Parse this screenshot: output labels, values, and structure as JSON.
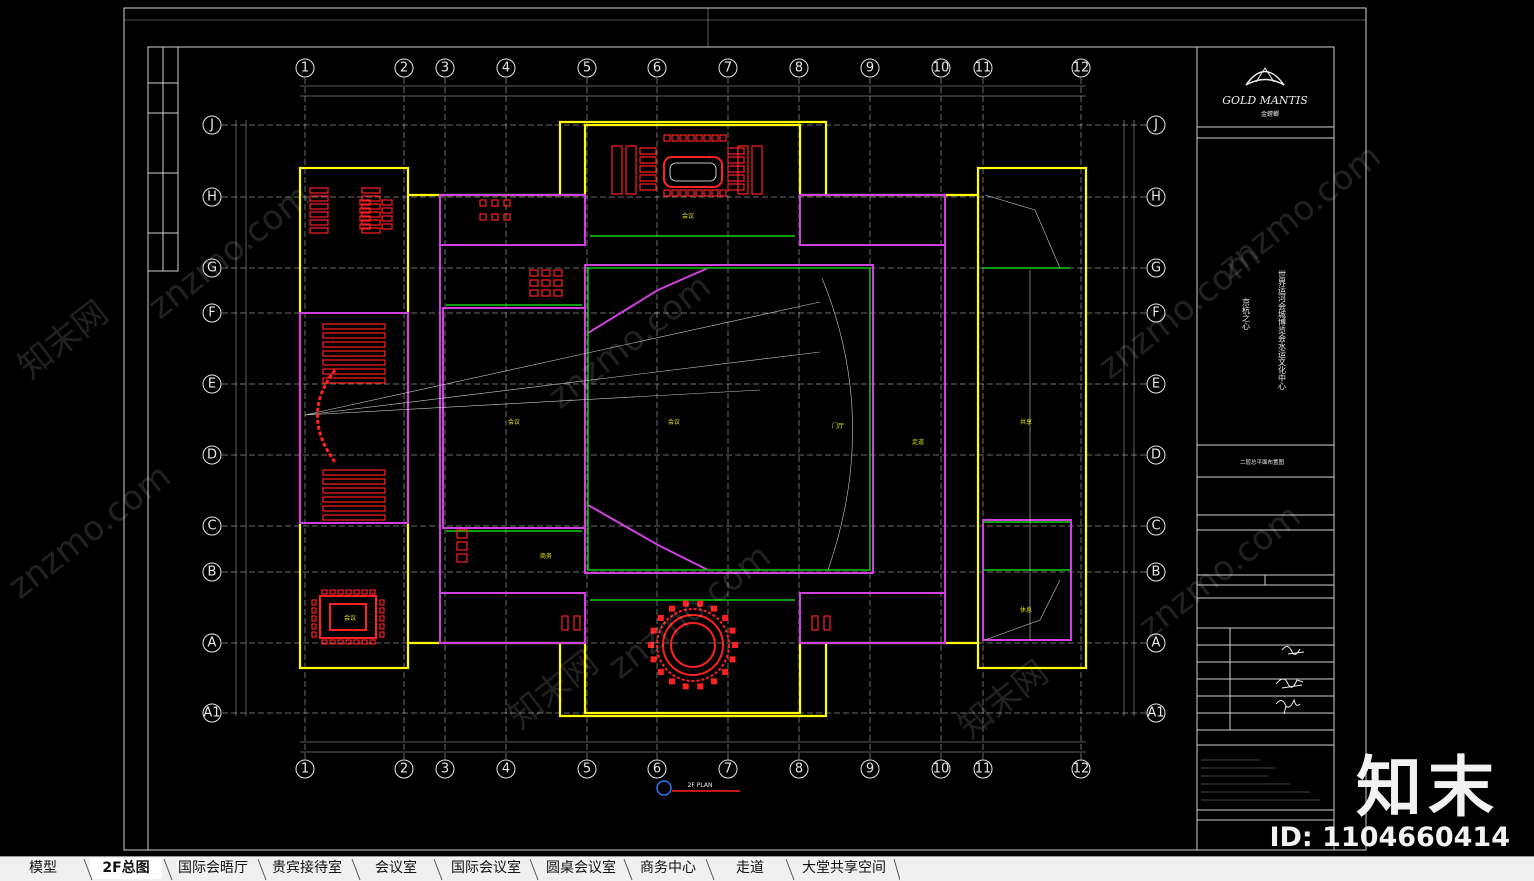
{
  "tabs": [
    {
      "label": "模型",
      "active": false
    },
    {
      "label": "2F总图",
      "active": true
    },
    {
      "label": "国际会晤厅",
      "active": false
    },
    {
      "label": "贵宾接待室",
      "active": false
    },
    {
      "label": "会议室",
      "active": false
    },
    {
      "label": "国际会议室",
      "active": false
    },
    {
      "label": "圆桌会议室",
      "active": false
    },
    {
      "label": "商务中心",
      "active": false
    },
    {
      "label": "走道",
      "active": false
    },
    {
      "label": "大堂共享空间",
      "active": false
    }
  ],
  "drawing": {
    "column_grid_labels": [
      "1",
      "2",
      "3",
      "4",
      "5",
      "6",
      "7",
      "8",
      "9",
      "10",
      "11",
      "12"
    ],
    "row_grid_labels": [
      "J",
      "H",
      "G",
      "F",
      "E",
      "D",
      "C",
      "B",
      "A",
      "A1"
    ],
    "title_block": {
      "logo_text": "GOLD MANTIS",
      "logo_cn": "金螳螂",
      "project_name_lines": [
        "京杭之心",
        "世界运河会城博览会水运文化中心"
      ],
      "drawing_title": "二层总平面布置图",
      "plan_label": "2F PLAN"
    },
    "colors": {
      "wall_yellow": "#ffff00",
      "partition_magenta": "#d040e0",
      "furniture_red": "#ff2020",
      "green_line": "#10d010",
      "grid_white": "#e0e0e0",
      "background": "#000000"
    }
  },
  "watermark": {
    "text": "znzmo.com",
    "cn_text": "知末网",
    "brand": "知末",
    "id_text": "ID: 1104660414"
  }
}
